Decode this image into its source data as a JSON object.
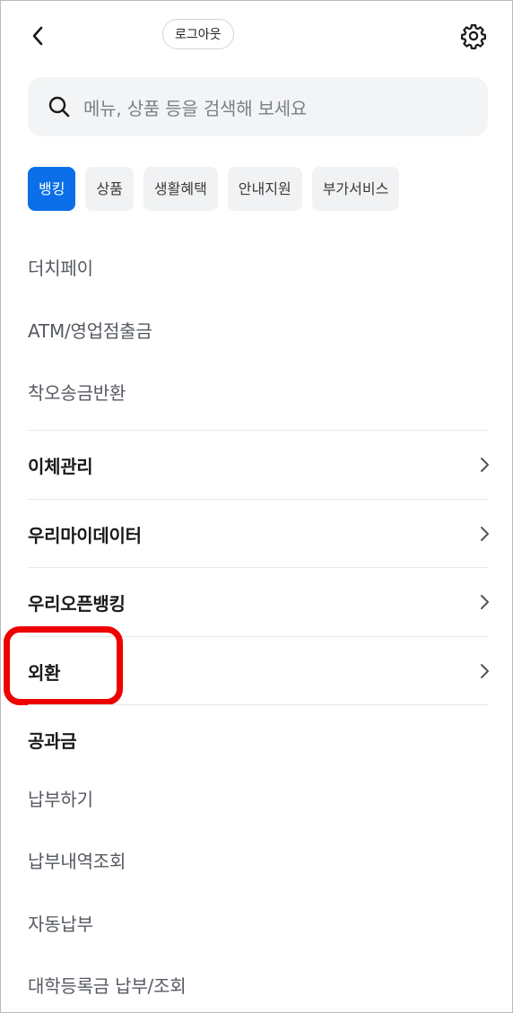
{
  "header": {
    "back_icon": "chevron-left-icon",
    "logout_label": "로그아웃",
    "settings_icon": "gear-icon"
  },
  "search": {
    "icon": "search-icon",
    "placeholder": "메뉴, 상품 등을 검색해 보세요"
  },
  "tabs": [
    {
      "label": "뱅킹",
      "active": true
    },
    {
      "label": "상품",
      "active": false
    },
    {
      "label": "생활혜택",
      "active": false
    },
    {
      "label": "안내지원",
      "active": false
    },
    {
      "label": "부가서비스",
      "active": false
    }
  ],
  "quick_items": [
    "더치페이",
    "ATM/영업점출금",
    "착오송금반환"
  ],
  "sections": [
    {
      "label": "이체관리"
    },
    {
      "label": "우리마이데이터"
    },
    {
      "label": "우리오픈뱅킹"
    },
    {
      "label": "외환"
    }
  ],
  "utility": {
    "title": "공과금",
    "items": [
      "납부하기",
      "납부내역조회",
      "자동납부",
      "대학등록금 납부/조회"
    ]
  },
  "colors": {
    "accent": "#0a6fe8",
    "highlight": "#ee0000",
    "chip_bg": "#f1f2f4",
    "search_bg": "#f3f4f6"
  }
}
